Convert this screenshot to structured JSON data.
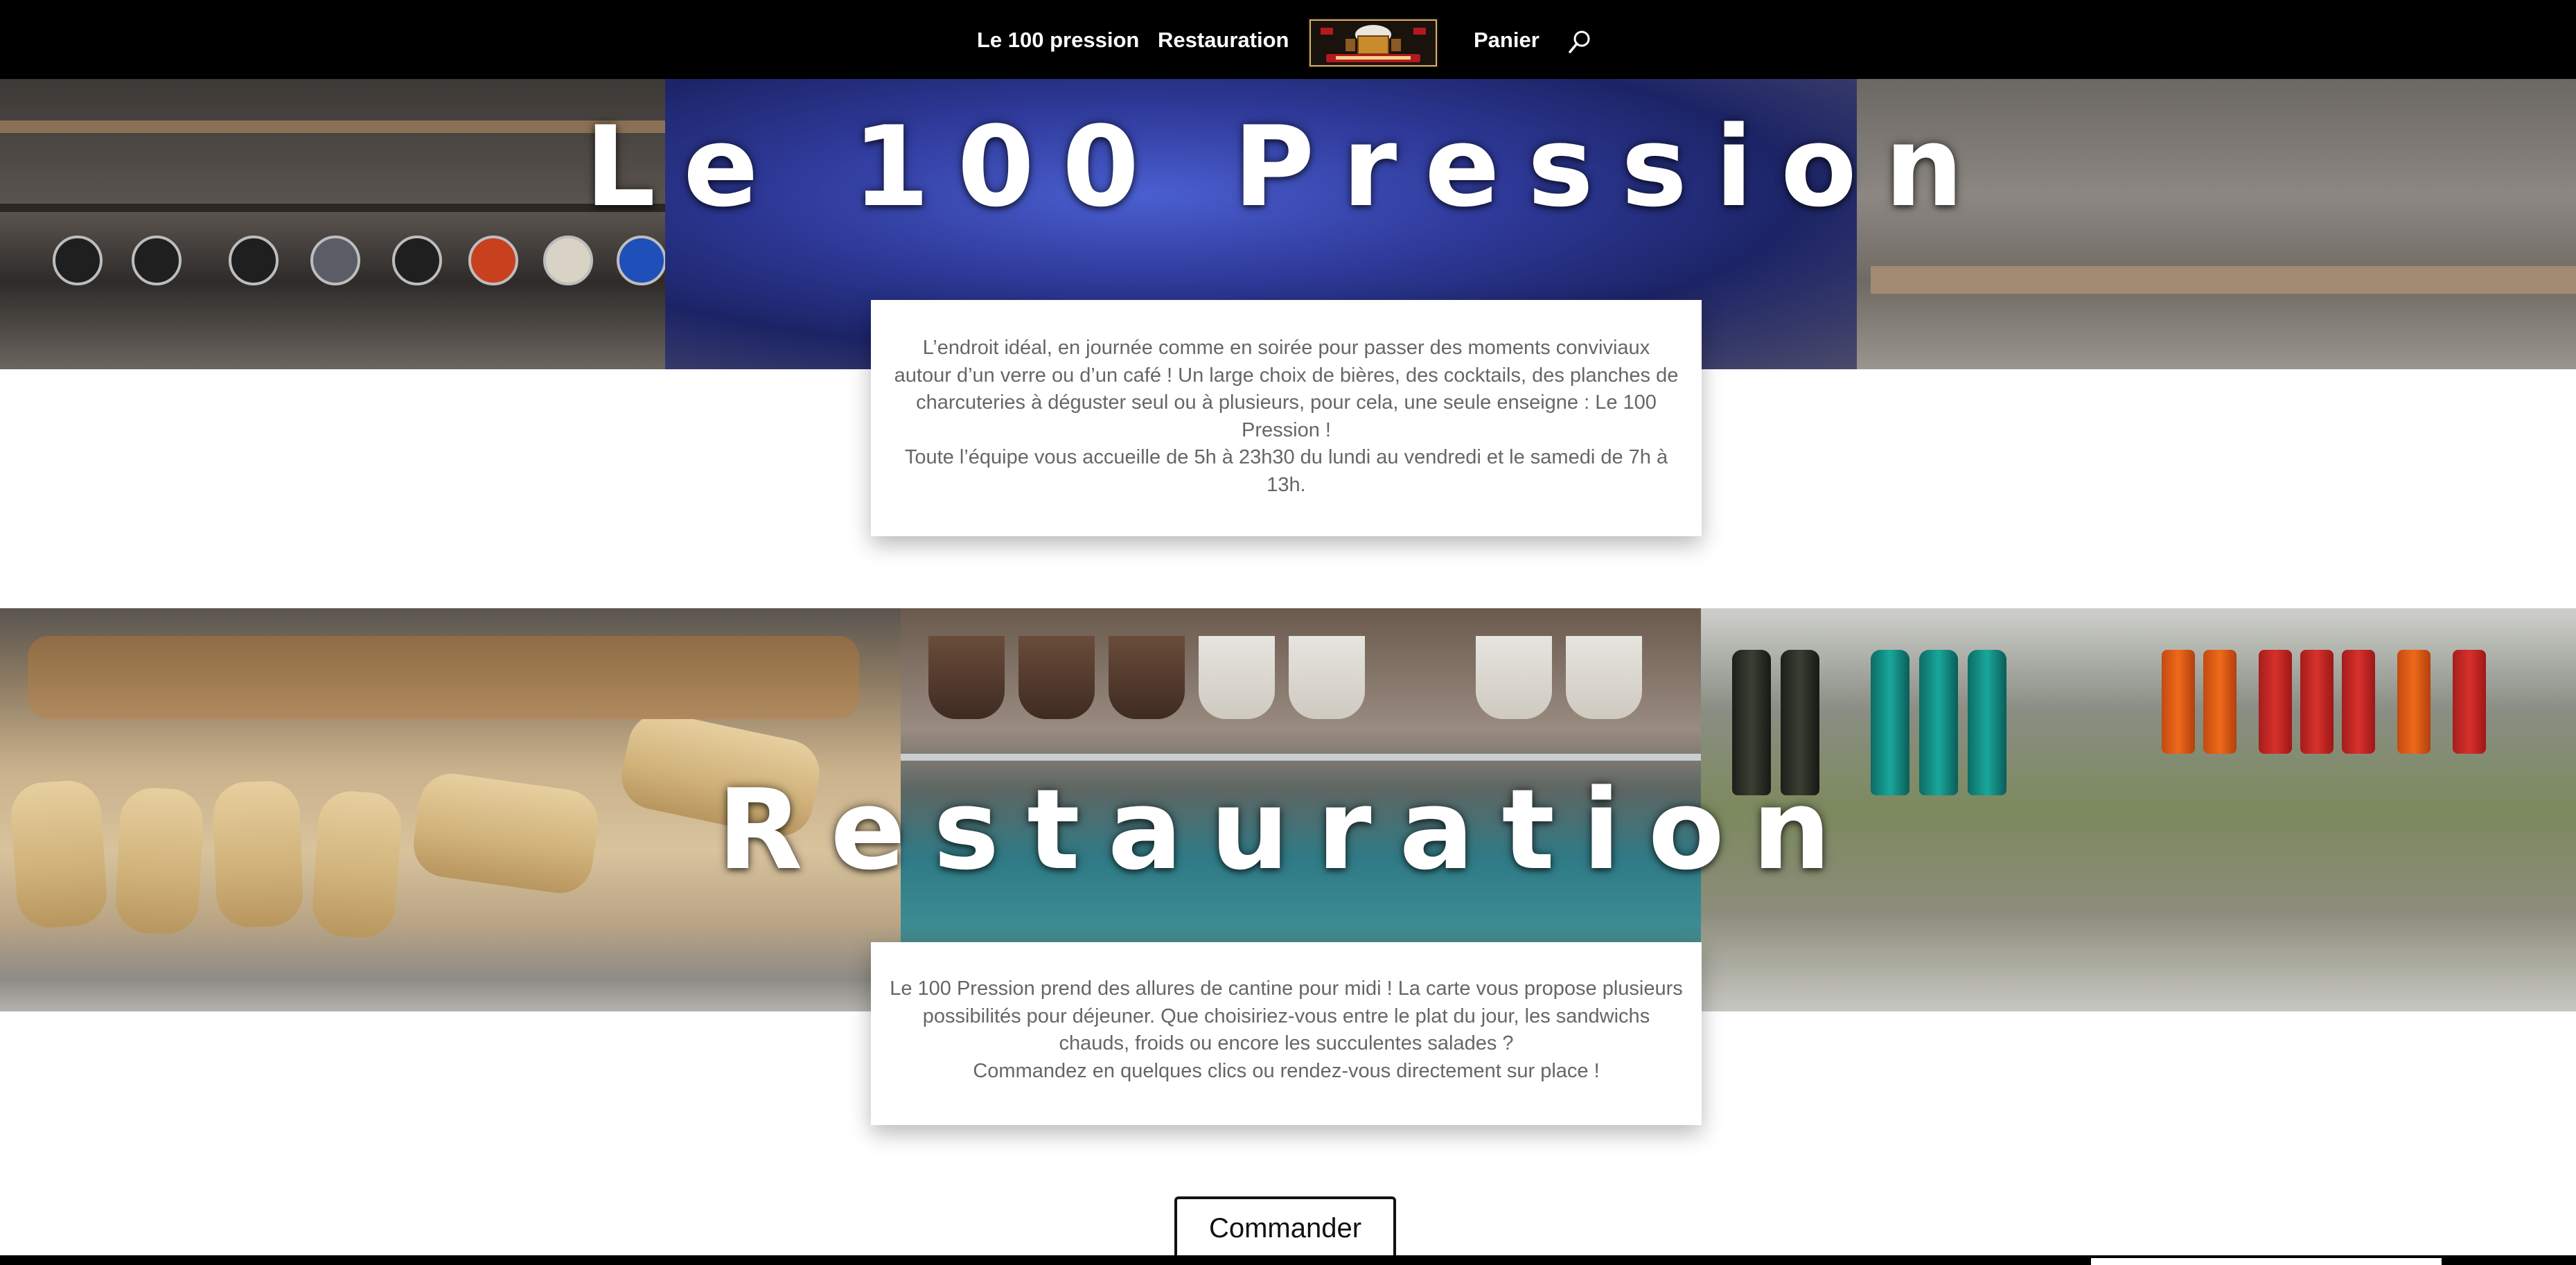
{
  "nav": {
    "items": [
      {
        "label": "Le 100 pression"
      },
      {
        "label": "Restauration"
      },
      {
        "label": "Panier"
      }
    ],
    "logo_icon": "bar-logo-icon",
    "search_icon": "search-icon",
    "background": "#000000",
    "text_color": "#ffffff"
  },
  "hero1": {
    "title": "Le 100 Pression"
  },
  "card1": {
    "paragraph1": "L’endroit idéal, en journée comme en soirée pour passer des moments conviviaux autour d’un verre ou d’un café ! Un large choix de bières, des cocktails, des planches de charcuteries à déguster seul ou à plusieurs, pour cela, une seule enseigne : Le 100 Pression !",
    "paragraph2": "Toute l’équipe vous accueille de 5h à 23h30 du lundi au vendredi et le samedi de 7h à 13h."
  },
  "hero2": {
    "title": "Restauration"
  },
  "card2": {
    "paragraph1": "Le 100 Pression prend des allures de cantine pour midi ! La carte vous propose plusieurs possibilités pour déjeuner. Que choisiriez-vous entre le plat du jour, les sandwichs chauds, froids ou encore les succulentes salades ?",
    "paragraph2": "Commandez en quelques clics ou rendez-vous directement sur place !"
  },
  "order_button": {
    "label": "Commander"
  },
  "colors": {
    "card_text": "#666666",
    "button_border": "#111111"
  }
}
